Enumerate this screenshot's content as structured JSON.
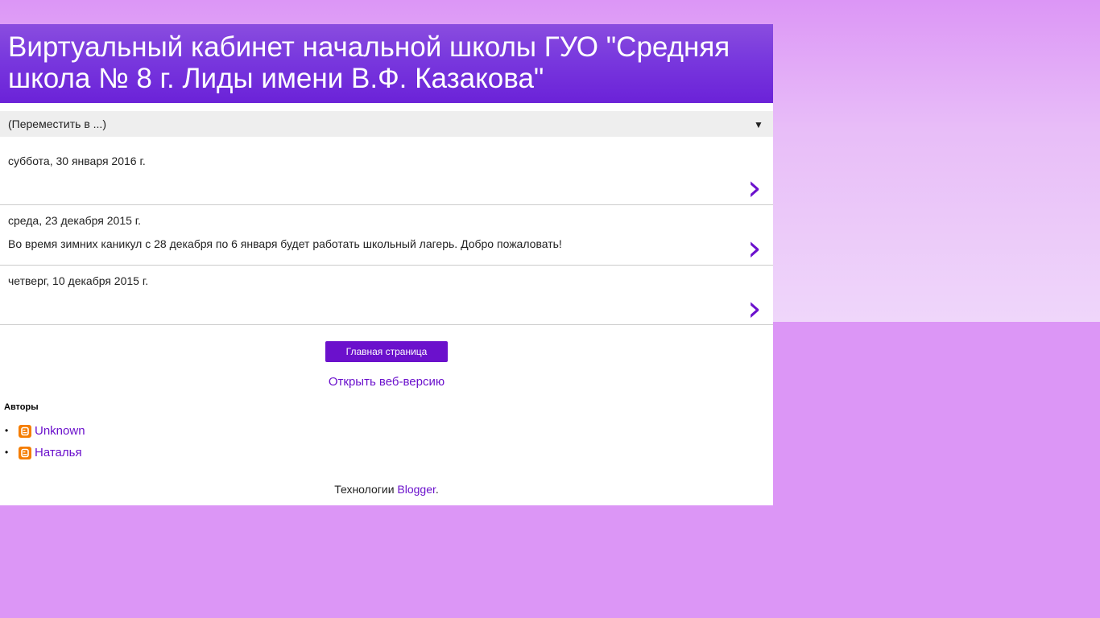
{
  "blog": {
    "title": "Виртуальный кабинет начальной школы ГУО \"Средняя школа № 8 г. Лиды имени В.Ф. Казакова\""
  },
  "navigation": {
    "select_label": "(Переместить в ...)",
    "select_arrow": "▼"
  },
  "posts": [
    {
      "date": "суббота, 30 января 2016 г.",
      "snippet": ""
    },
    {
      "date": "среда, 23 декабря 2015 г.",
      "snippet": "Во время зимних каникул с 28 декабря  по 6 января будет работать школьный лагерь. Добро пожаловать!"
    },
    {
      "date": "четверг, 10 декабря 2015 г.",
      "snippet": ""
    }
  ],
  "footer": {
    "home_button": "Главная страница",
    "web_version_link": "Открыть веб-версию",
    "authors_title": "Авторы",
    "authors": [
      {
        "name": "Unknown"
      },
      {
        "name": "Наталья"
      }
    ],
    "powered_prefix": "Технологии ",
    "powered_link": "Blogger",
    "powered_suffix": "."
  },
  "colors": {
    "background": "#dc96f6",
    "header": "#7a3ade",
    "accent": "#6b11cc",
    "blogger_orange": "#f57d00"
  },
  "icons": {
    "post_link": "chevron-right-icon",
    "author_profile": "blogger-icon",
    "select_dropdown": "triangle-down-icon"
  }
}
